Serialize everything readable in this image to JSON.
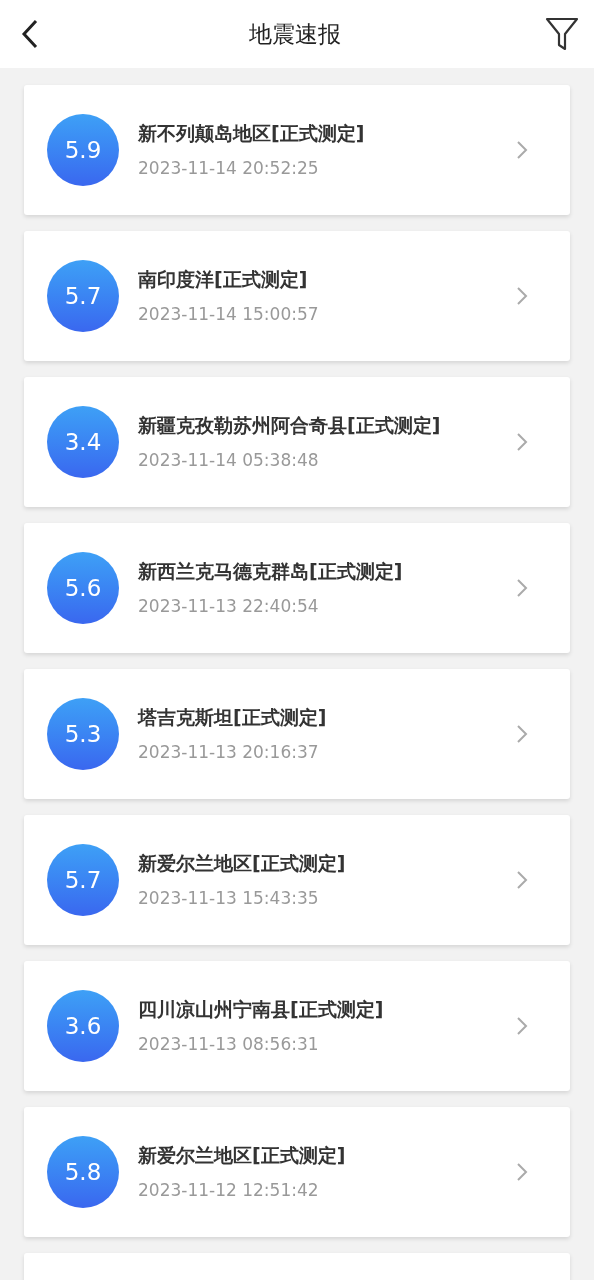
{
  "header": {
    "title": "地震速报"
  },
  "quakes": [
    {
      "magnitude": "5.9",
      "place": "新不列颠岛地区[正式测定]",
      "time": "2023-11-14 20:52:25"
    },
    {
      "magnitude": "5.7",
      "place": "南印度洋[正式测定]",
      "time": "2023-11-14 15:00:57"
    },
    {
      "magnitude": "3.4",
      "place": "新疆克孜勒苏州阿合奇县[正式测定]",
      "time": "2023-11-14 05:38:48"
    },
    {
      "magnitude": "5.6",
      "place": "新西兰克马德克群岛[正式测定]",
      "time": "2023-11-13 22:40:54"
    },
    {
      "magnitude": "5.3",
      "place": "塔吉克斯坦[正式测定]",
      "time": "2023-11-13 20:16:37"
    },
    {
      "magnitude": "5.7",
      "place": "新爱尔兰地区[正式测定]",
      "time": "2023-11-13 15:43:35"
    },
    {
      "magnitude": "3.6",
      "place": "四川凉山州宁南县[正式测定]",
      "time": "2023-11-13 08:56:31"
    },
    {
      "magnitude": "5.8",
      "place": "新爱尔兰地区[正式测定]",
      "time": "2023-11-12 12:51:42"
    }
  ]
}
